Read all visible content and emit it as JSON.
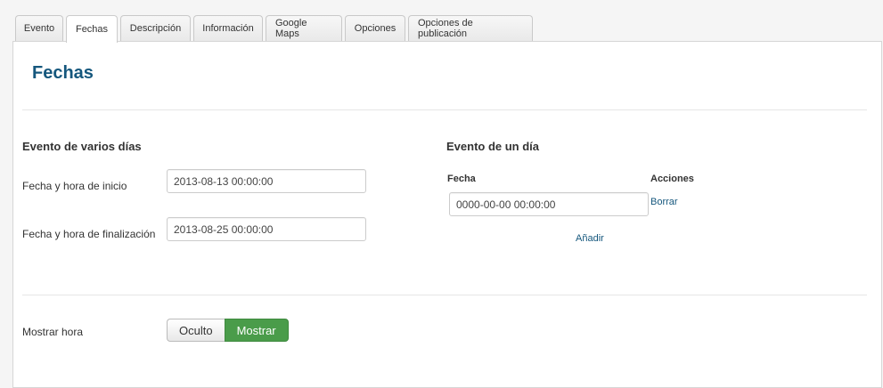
{
  "tabs": [
    {
      "label": "Evento"
    },
    {
      "label": "Fechas"
    },
    {
      "label": "Descripción"
    },
    {
      "label": "Información"
    },
    {
      "label": "Google Maps"
    },
    {
      "label": "Opciones"
    },
    {
      "label": "Opciones de publicación"
    }
  ],
  "active_tab": "Fechas",
  "page": {
    "title": "Fechas"
  },
  "multi_day": {
    "heading": "Evento de varios días",
    "start_label": "Fecha y hora de inicio",
    "start_value": "2013-08-13 00:00:00",
    "end_label": "Fecha y hora de finalización",
    "end_value": "2013-08-25 00:00:00"
  },
  "single_day": {
    "heading": "Evento de un día",
    "col_date": "Fecha",
    "col_actions": "Acciones",
    "date_value": "0000-00-00 00:00:00",
    "delete_label": "Borrar",
    "add_label": "Añadir"
  },
  "show_time": {
    "label": "Mostrar hora",
    "off_label": "Oculto",
    "on_label": "Mostrar",
    "selected": "Mostrar"
  },
  "colors": {
    "title": "#15577d",
    "link": "#15577d",
    "toggle_active": "#4a9c4a"
  }
}
